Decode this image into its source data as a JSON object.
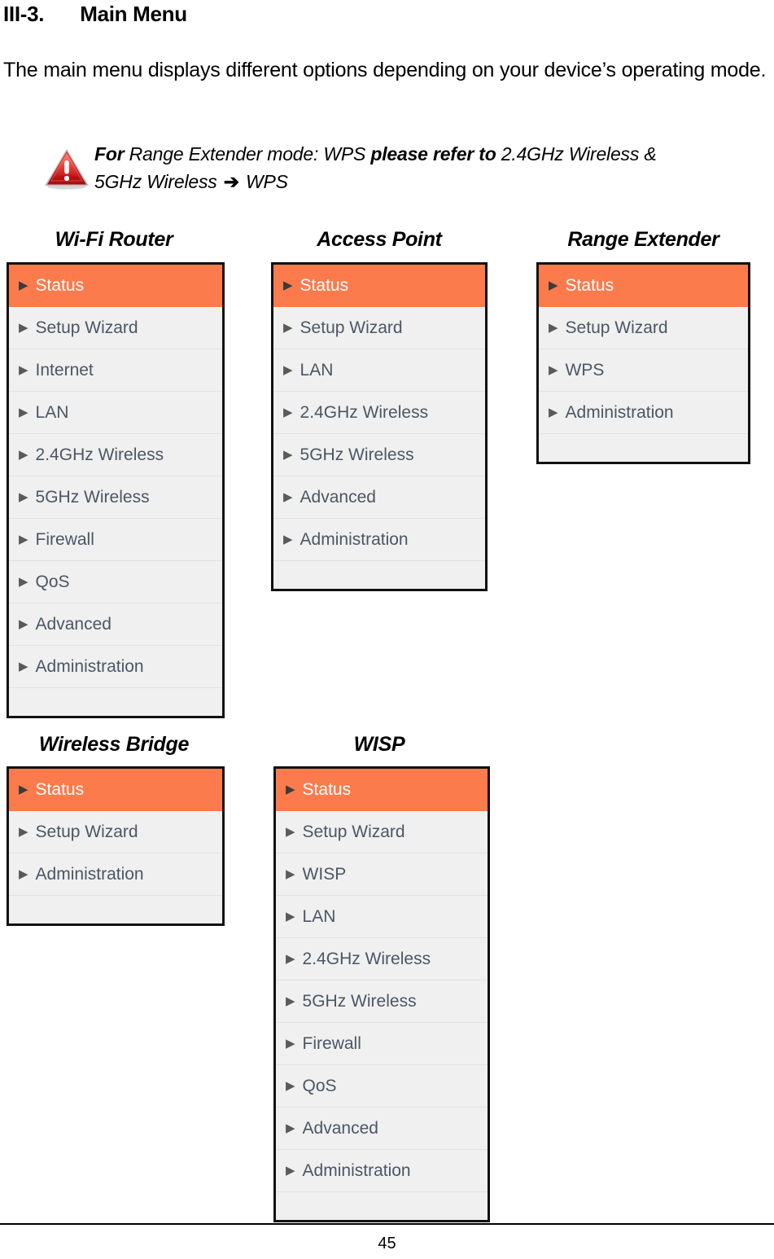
{
  "heading": {
    "number": "III-3.",
    "title": "Main Menu"
  },
  "intro": "The main menu displays different options depending on your device’s operating mode.",
  "note": {
    "icon": "warning-triangle-icon",
    "line1_bold_1": "For",
    "line1_italic_1": " Range Extender mode: WPS ",
    "line1_bold_2": "please refer to",
    "line1_italic_2": " 2.4GHz Wireless &",
    "line2_italic_1": "5GHz Wireless ",
    "line2_arrow": "➔",
    "line2_italic_2": " WPS"
  },
  "menus": [
    {
      "title": "Wi-Fi Router",
      "items": [
        "Status",
        "Setup Wizard",
        "Internet",
        "LAN",
        "2.4GHz Wireless",
        "5GHz Wireless",
        "Firewall",
        "QoS",
        "Advanced",
        "Administration"
      ],
      "active_index": 0
    },
    {
      "title": "Access Point",
      "items": [
        "Status",
        "Setup Wizard",
        "LAN",
        "2.4GHz Wireless",
        "5GHz Wireless",
        "Advanced",
        "Administration"
      ],
      "active_index": 0
    },
    {
      "title": "Range Extender",
      "items": [
        "Status",
        "Setup Wizard",
        "WPS",
        "Administration"
      ],
      "active_index": 0
    },
    {
      "title": "Wireless Bridge",
      "items": [
        "Status",
        "Setup Wizard",
        "Administration"
      ],
      "active_index": 0
    },
    {
      "title": "WISP",
      "items": [
        "Status",
        "Setup Wizard",
        "WISP",
        "LAN",
        "2.4GHz Wireless",
        "5GHz Wireless",
        "Firewall",
        "QoS",
        "Advanced",
        "Administration"
      ],
      "active_index": 0
    }
  ],
  "caret_glyph": "▶",
  "colors": {
    "active_row": "#fb7b4d",
    "row_background": "#f0f0f0",
    "row_text": "#4b5665",
    "border": "#111111",
    "warning_icon": "#cc0000"
  },
  "footer": {
    "page_number": "45"
  }
}
